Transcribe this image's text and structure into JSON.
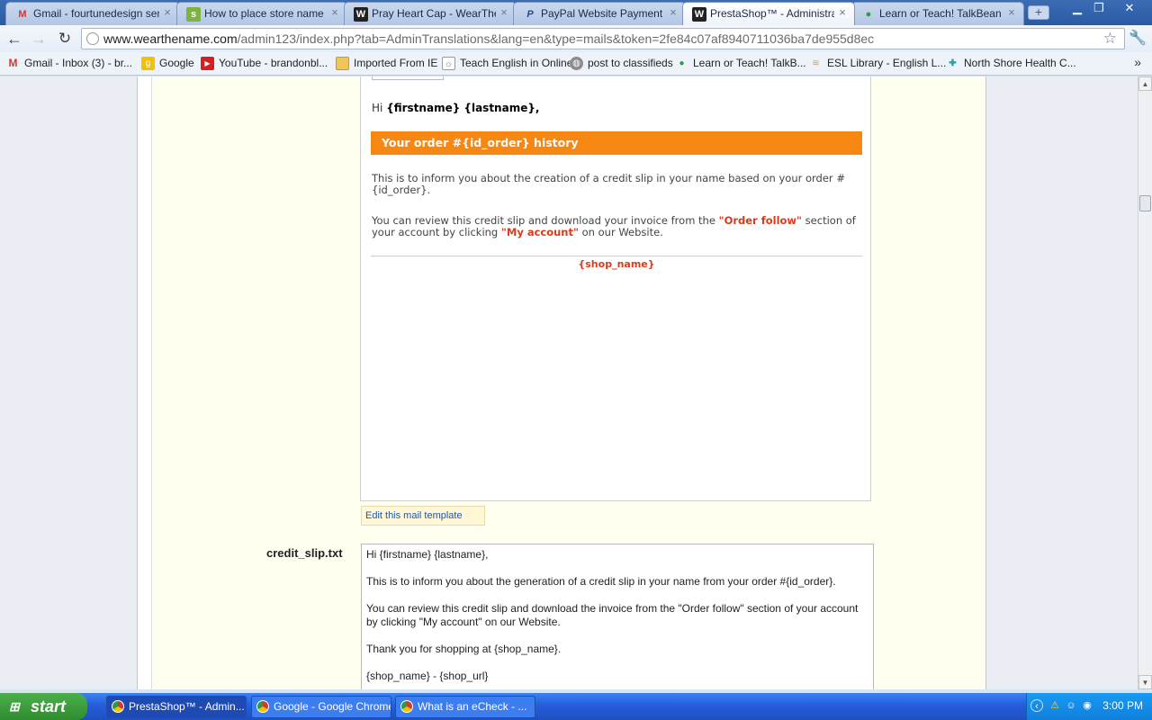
{
  "browser": {
    "tabs": [
      {
        "label": "Gmail - fourtunedesign sent y",
        "icon": "gmail-icon",
        "active": false
      },
      {
        "label": "How to place store name but",
        "icon": "shopify-icon",
        "active": false
      },
      {
        "label": "Pray Heart Cap - WearTheNa",
        "icon": "wtn-icon",
        "active": false
      },
      {
        "label": "PayPal Website Payment Det",
        "icon": "paypal-icon",
        "active": false
      },
      {
        "label": "PrestaShop™ - Administration",
        "icon": "wtn-icon",
        "active": true
      },
      {
        "label": "Learn or Teach! TalkBean",
        "icon": "talkbean-icon",
        "active": false
      }
    ],
    "url_host": "www.wearthename.com",
    "url_path": "/admin123/index.php?tab=AdminTranslations&lang=en&type=mails&token=2fe84c07af8940711036ba7de955d8ec",
    "bookmarks": [
      {
        "label": "Gmail - Inbox (3) - br...",
        "icon": "gmail-icon"
      },
      {
        "label": "Google",
        "icon": "google-icon"
      },
      {
        "label": "YouTube - brandonbl...",
        "icon": "youtube-icon"
      },
      {
        "label": "Imported From IE",
        "icon": "folder-icon"
      },
      {
        "label": "Teach English in Online",
        "icon": "page-icon"
      },
      {
        "label": "post to classifieds",
        "icon": "globe-icon"
      },
      {
        "label": "Learn or Teach! TalkB...",
        "icon": "talkbean-icon"
      },
      {
        "label": "ESL Library - English L...",
        "icon": "esl-icon"
      },
      {
        "label": "North Shore Health C...",
        "icon": "health-icon"
      }
    ]
  },
  "mail_preview": {
    "greeting_prefix": "Hi",
    "greeting_name": "{firstname} {lastname},",
    "header": "Your order #{id_order} history",
    "para1": "This is to inform you about the creation of a credit slip in your name based on your order #{id_order}.",
    "para2_a": "You can review this credit slip and download your invoice from the ",
    "para2_hl1": "\"Order follow\"",
    "para2_b": " section of your account by clicking ",
    "para2_hl2": "\"My account\"",
    "para2_c": " on our Website.",
    "shop_name": "{shop_name}",
    "accent_color": "#f68712",
    "highlight_color": "#db3a1b"
  },
  "edit_link": "Edit this mail template",
  "text_template": {
    "filename": "credit_slip.txt",
    "content": "Hi {firstname} {lastname},\n\nThis is to inform you about the generation of a credit slip in your name from your order #{id_order}.\n\nYou can review this credit slip and download the invoice from the \"Order follow\" section of your account by clicking \"My account\" on our Website.\n\nThank you for shopping at {shop_name}.\n\n{shop_name} - {shop_url}"
  },
  "taskbar": {
    "start_label": "start",
    "tasks": [
      {
        "label": "PrestaShop™ - Admin...",
        "active": true
      },
      {
        "label": "Google - Google Chrome",
        "active": false
      },
      {
        "label": "What is an eCheck - ...",
        "active": false
      }
    ],
    "clock": "3:00 PM"
  }
}
